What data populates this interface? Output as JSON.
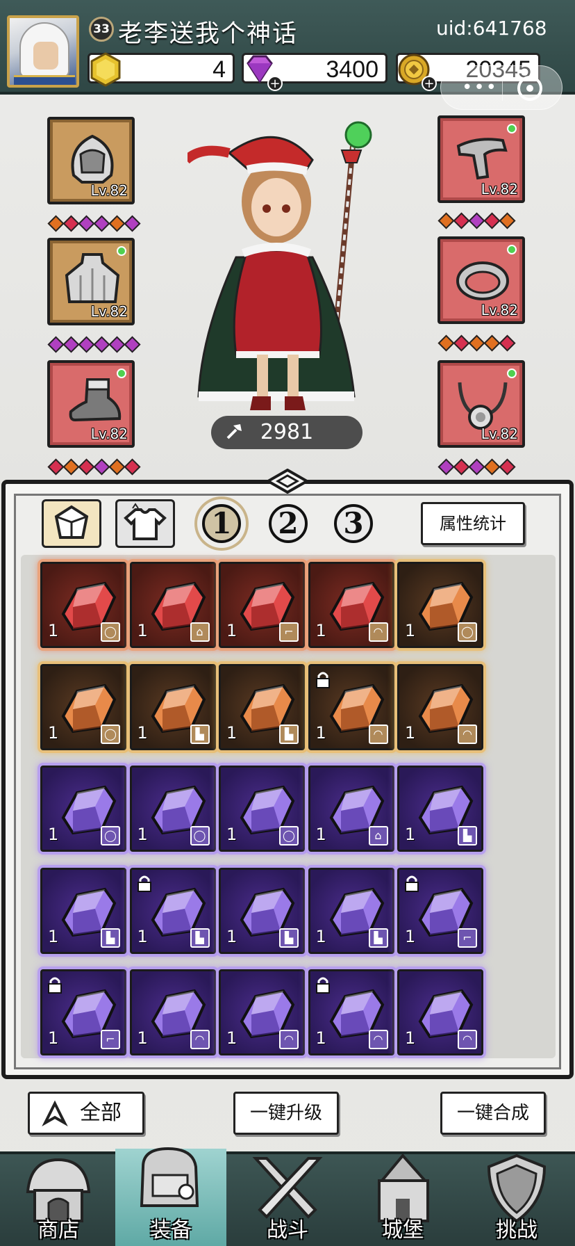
{
  "player": {
    "level": "33",
    "name": "老李送我个神话",
    "uid": "uid:641768"
  },
  "resources": [
    {
      "icon": "hex-coin-icon",
      "value": "4"
    },
    {
      "icon": "diamond-icon",
      "value": "3400"
    },
    {
      "icon": "gold-coin-icon",
      "value": "20345"
    }
  ],
  "equipment": {
    "left": [
      {
        "item": "helmet-icon",
        "level": "Lv.82",
        "frame": "gold",
        "badge": false,
        "stars": [
          "#e07020",
          "#d63050",
          "#b040c0",
          "#b040c0",
          "#e07020",
          "#b040c0"
        ]
      },
      {
        "item": "cape-icon",
        "level": "Lv.82",
        "frame": "gold",
        "badge": true,
        "stars": [
          "#b040c0",
          "#b040c0",
          "#b040c0",
          "#b040c0",
          "#b040c0",
          "#b040c0"
        ]
      },
      {
        "item": "boot-icon",
        "level": "Lv.82",
        "frame": "red",
        "badge": true,
        "stars": [
          "#d63050",
          "#e07020",
          "#d63050",
          "#b040c0",
          "#e07020",
          "#d63050"
        ]
      }
    ],
    "right": [
      {
        "item": "pipe-icon",
        "level": "Lv.82",
        "frame": "red",
        "badge": true,
        "stars": [
          "#e07020",
          "#d63050",
          "#b040c0",
          "#d63050",
          "#e07020"
        ]
      },
      {
        "item": "ring-icon",
        "level": "Lv.82",
        "frame": "red",
        "badge": true,
        "stars": [
          "#e07020",
          "#d63050",
          "#e07020",
          "#e07020",
          "#d63050"
        ]
      },
      {
        "item": "necklace-icon",
        "level": "Lv.82",
        "frame": "red",
        "badge": true,
        "stars": [
          "#b040c0",
          "#d63050",
          "#b040c0",
          "#e07020",
          "#d63050"
        ]
      }
    ]
  },
  "power": "2981",
  "tabs": {
    "filters": [
      "gem-filter-icon",
      "shirt-filter-icon"
    ],
    "pages": [
      "1",
      "2",
      "3"
    ],
    "active_page": "1",
    "stats_label": "属性统计"
  },
  "inventory": [
    {
      "rarity": "red",
      "count": "1",
      "type": "ring",
      "locked": false
    },
    {
      "rarity": "red",
      "count": "1",
      "type": "cape",
      "locked": false
    },
    {
      "rarity": "red",
      "count": "1",
      "type": "pipe",
      "locked": false
    },
    {
      "rarity": "red",
      "count": "1",
      "type": "hat",
      "locked": false
    },
    {
      "rarity": "orange",
      "count": "1",
      "type": "ring",
      "locked": false
    },
    {
      "rarity": "orange",
      "count": "1",
      "type": "ring",
      "locked": false
    },
    {
      "rarity": "orange",
      "count": "1",
      "type": "boot",
      "locked": false
    },
    {
      "rarity": "orange",
      "count": "1",
      "type": "boot",
      "locked": false
    },
    {
      "rarity": "orange",
      "count": "1",
      "type": "hat",
      "locked": true
    },
    {
      "rarity": "orange",
      "count": "1",
      "type": "hat",
      "locked": false
    },
    {
      "rarity": "purple",
      "count": "1",
      "type": "ring",
      "locked": false
    },
    {
      "rarity": "purple",
      "count": "1",
      "type": "ring",
      "locked": false
    },
    {
      "rarity": "purple",
      "count": "1",
      "type": "ring",
      "locked": false
    },
    {
      "rarity": "purple",
      "count": "1",
      "type": "cape",
      "locked": false
    },
    {
      "rarity": "purple",
      "count": "1",
      "type": "boot",
      "locked": false
    },
    {
      "rarity": "purple",
      "count": "1",
      "type": "boot",
      "locked": false
    },
    {
      "rarity": "purple",
      "count": "1",
      "type": "boot",
      "locked": true
    },
    {
      "rarity": "purple",
      "count": "1",
      "type": "boot",
      "locked": false
    },
    {
      "rarity": "purple",
      "count": "1",
      "type": "boot",
      "locked": false
    },
    {
      "rarity": "purple",
      "count": "1",
      "type": "pipe",
      "locked": true
    },
    {
      "rarity": "purple",
      "count": "1",
      "type": "pipe",
      "locked": true
    },
    {
      "rarity": "purple",
      "count": "1",
      "type": "hat",
      "locked": false
    },
    {
      "rarity": "purple",
      "count": "1",
      "type": "hat",
      "locked": false
    },
    {
      "rarity": "purple",
      "count": "1",
      "type": "hat",
      "locked": true
    },
    {
      "rarity": "purple",
      "count": "1",
      "type": "hat",
      "locked": false
    }
  ],
  "actions": {
    "all": "全部",
    "upgrade": "一键升级",
    "merge": "一键合成"
  },
  "nav": [
    {
      "label": "商店",
      "icon": "shop-icon",
      "active": false
    },
    {
      "label": "装备",
      "icon": "backpack-icon",
      "active": true
    },
    {
      "label": "战斗",
      "icon": "swords-icon",
      "active": false
    },
    {
      "label": "城堡",
      "icon": "castle-icon",
      "active": false
    },
    {
      "label": "挑战",
      "icon": "shield-icon",
      "active": false
    }
  ],
  "colors": {
    "red": "#d63050",
    "orange": "#e07020",
    "purple": "#b040c0",
    "topbar": "#3f5a58"
  }
}
